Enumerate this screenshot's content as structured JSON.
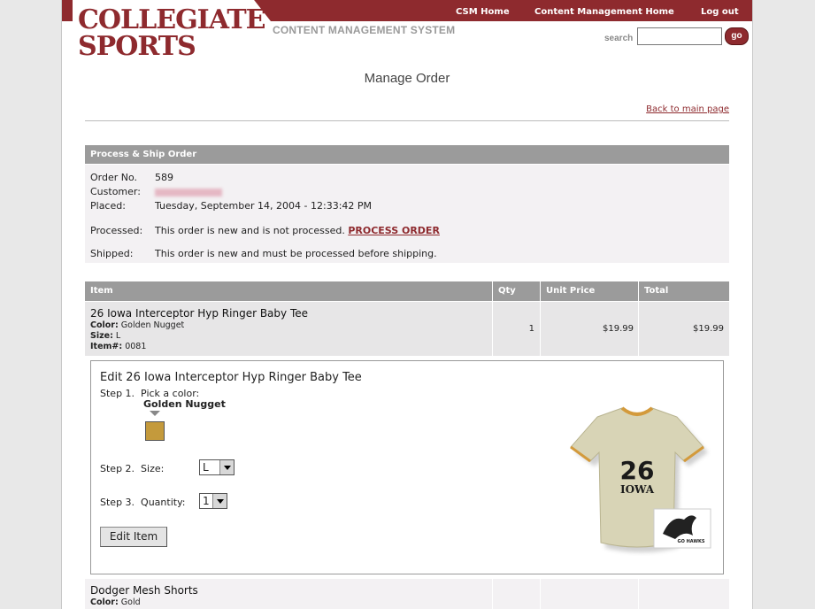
{
  "header": {
    "logo_line1": "COLLEGIATE",
    "logo_line2": "SPORTS",
    "subtitle": "CONTENT MANAGEMENT SYSTEM",
    "nav": [
      "CSM Home",
      "Content Management Home",
      "Log out"
    ],
    "search_label": "search",
    "search_value": "",
    "go_label": "go"
  },
  "page": {
    "title": "Manage Order",
    "back_link": "Back to main page"
  },
  "process": {
    "heading": "Process & Ship Order",
    "order_label": "Order No.",
    "order_value": "589",
    "customer_label": "Customer:",
    "placed_label": "Placed:",
    "placed_value": "Tuesday, September 14, 2004 - 12:33:42 PM",
    "processed_label": "Processed:",
    "processed_value": "This order is new and is not processed.",
    "process_link": "PROCESS ORDER",
    "shipped_label": "Shipped:",
    "shipped_value": "This order is new and must be processed before shipping."
  },
  "table": {
    "headers": [
      "Item",
      "Qty",
      "Unit Price",
      "Total"
    ],
    "rows": [
      {
        "name": "26 Iowa Interceptor Hyp Ringer Baby Tee",
        "color_label": "Color:",
        "color": "Golden Nugget",
        "size_label": "Size:",
        "size": "L",
        "item_label": "Item#:",
        "item_no": "0081",
        "qty": "1",
        "unit_price": "$19.99",
        "total": "$19.99"
      },
      {
        "name": "Dodger Mesh Shorts",
        "color_label": "Color:",
        "color": "Gold"
      }
    ]
  },
  "edit": {
    "title": "Edit 26 Iowa Interceptor Hyp Ringer Baby Tee",
    "step1": "Step 1.",
    "step1_text": "Pick a color:",
    "color_selected": "Golden Nugget",
    "step2": "Step 2.",
    "step2_text": "Size:",
    "size_value": "L",
    "step3": "Step 3.",
    "step3_text": "Quantity:",
    "qty_value": "1",
    "button": "Edit Item",
    "shirt_text1": "26",
    "shirt_text2": "IOWA",
    "logo_text": "GO HAWKS"
  },
  "colors": {
    "brand": "#8e2a2e",
    "header_gray": "#9b9b9b",
    "swatch": "#c49a3c"
  }
}
